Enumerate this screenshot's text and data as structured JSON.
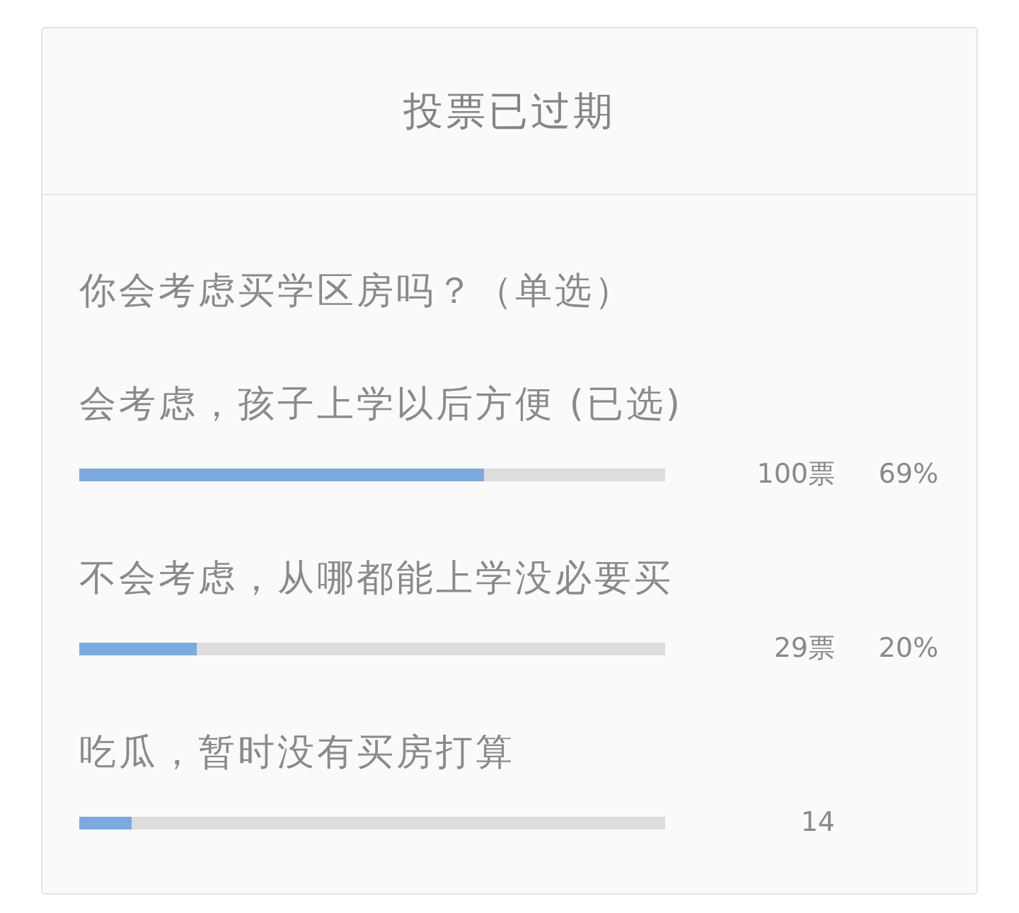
{
  "header": {
    "title": "投票已过期"
  },
  "question": "你会考虑买学区房吗？（单选）",
  "options": [
    {
      "label": "会考虑，孩子上学以后方便 (已选)",
      "level": 0.69,
      "votes": "100票",
      "percentage": "69%"
    },
    {
      "label": "不会考虑，从哪都能上学没必要买",
      "level": 0.2,
      "votes": "29票",
      "percentage": "20%"
    },
    {
      "label": "吃瓜，暂时没有买房打算",
      "level": 0.09,
      "votes": "14"
    }
  ]
}
